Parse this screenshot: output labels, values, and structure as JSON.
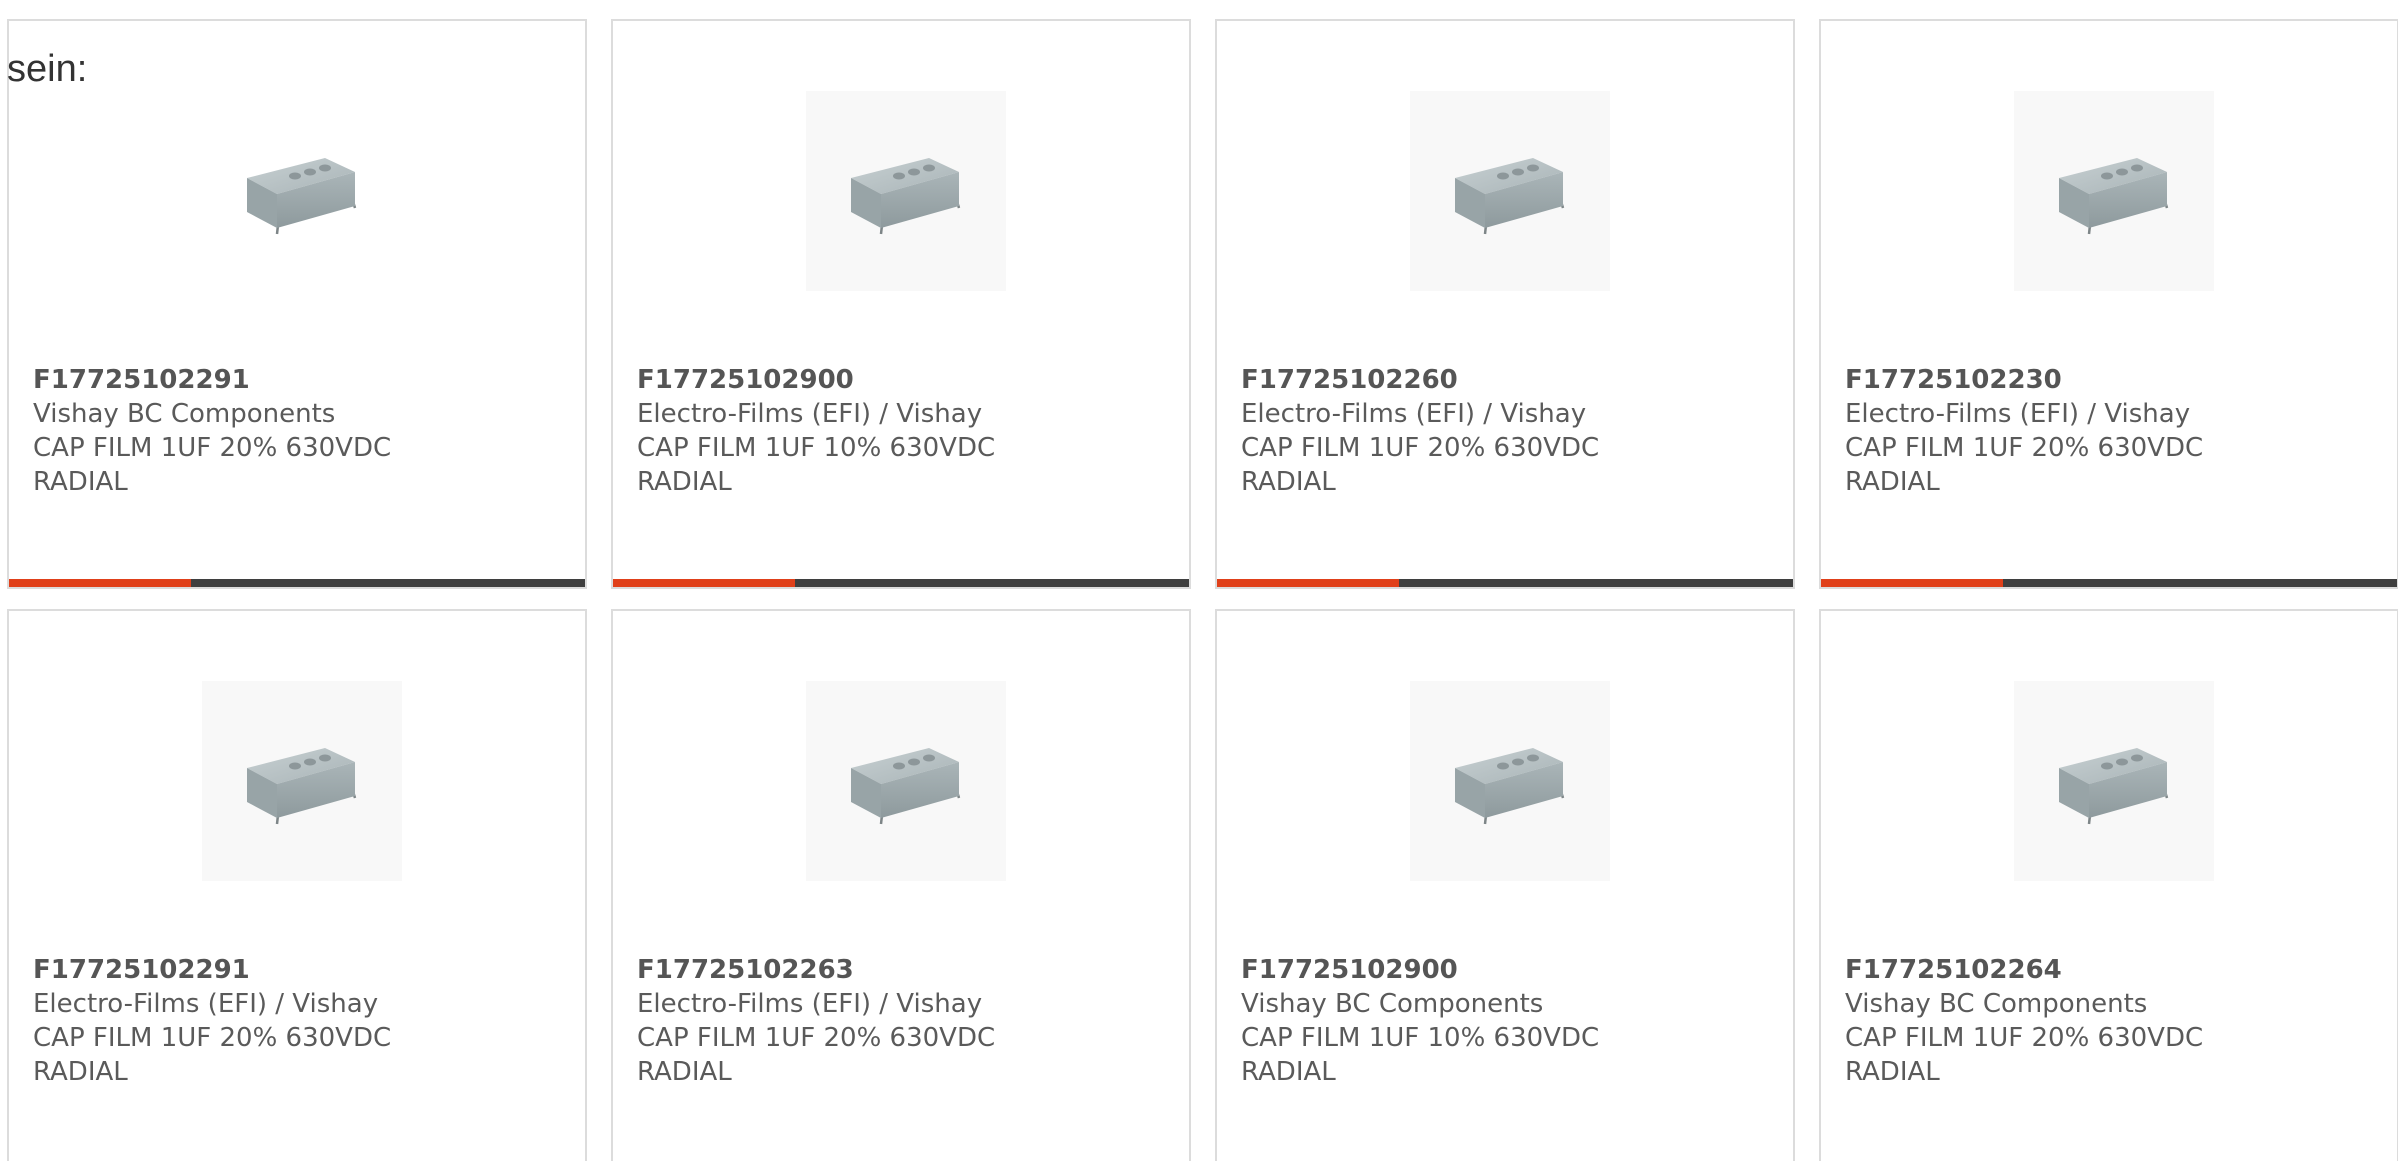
{
  "intro_text": "sein:",
  "colors": {
    "accent": "#e0401a",
    "bar_dark": "#3f3f3f",
    "card_border": "#dcdcdc"
  },
  "products": [
    {
      "part": "F17725102291",
      "maker": "Vishay BC Components",
      "desc": "CAP FILM 1UF 20% 630VDC",
      "package": "RADIAL",
      "image": "capacitor-image",
      "hover_bar": true
    },
    {
      "part": "F17725102900",
      "maker": "Electro-Films (EFI) / Vishay",
      "desc": "CAP FILM 1UF 10% 630VDC",
      "package": "RADIAL",
      "image": "capacitor-image",
      "hover_bar": true
    },
    {
      "part": "F17725102260",
      "maker": "Electro-Films (EFI) / Vishay",
      "desc": "CAP FILM 1UF 20% 630VDC",
      "package": "RADIAL",
      "image": "capacitor-image",
      "hover_bar": true
    },
    {
      "part": "F17725102230",
      "maker": "Electro-Films (EFI) / Vishay",
      "desc": "CAP FILM 1UF 20% 630VDC",
      "package": "RADIAL",
      "image": "capacitor-image",
      "hover_bar": true
    },
    {
      "part": "F17725102291",
      "maker": "Electro-Films (EFI) / Vishay",
      "desc": "CAP FILM 1UF 20% 630VDC",
      "package": "RADIAL",
      "image": "capacitor-image",
      "hover_bar": false
    },
    {
      "part": "F17725102263",
      "maker": "Electro-Films (EFI) / Vishay",
      "desc": "CAP FILM 1UF 20% 630VDC",
      "package": "RADIAL",
      "image": "capacitor-image",
      "hover_bar": false
    },
    {
      "part": "F17725102900",
      "maker": "Vishay BC Components",
      "desc": "CAP FILM 1UF 10% 630VDC",
      "package": "RADIAL",
      "image": "capacitor-image",
      "hover_bar": false
    },
    {
      "part": "F17725102264",
      "maker": "Vishay BC Components",
      "desc": "CAP FILM 1UF 20% 630VDC",
      "package": "RADIAL",
      "image": "capacitor-image",
      "hover_bar": false
    }
  ]
}
